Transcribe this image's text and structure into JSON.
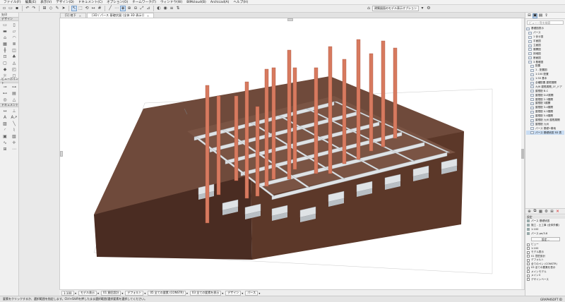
{
  "menu": [
    "ファイル(F)",
    "編集(E)",
    "表示(V)",
    "デザイン(D)",
    "ドキュメント(C)",
    "オプション(O)",
    "チームワーク(T)",
    "ウィンドウ(W)",
    "BIMcloud(B)",
    "Archicad(A)",
    "ヘルプ(H)"
  ],
  "toolbar": {
    "view_dropdown": "建築図面のモデル表示オプション",
    "suffix": "・"
  },
  "toolbox": {
    "header": "矢印",
    "categories": [
      "デザイン",
      "ビューポイント",
      "ドキュメント"
    ]
  },
  "tabs": [
    {
      "label": "[1] 地下",
      "active": false
    },
    {
      "label": "[3D / パース 基礎伏図 (全体 3D 表示)]",
      "active": true
    }
  ],
  "viewbar": [
    {
      "label": "",
      "value": "1:100"
    },
    {
      "label": "モデル表示",
      "value": ""
    },
    {
      "label": "",
      "value": "01 意匠設計"
    },
    {
      "label": "",
      "value": "デフォルト"
    },
    {
      "label": "",
      "value": "05 全ての要素 (CONSTR)"
    },
    {
      "label": "",
      "value": "03 全ての要素を表示"
    },
    {
      "label": "",
      "value": "デザイン"
    },
    {
      "label": "",
      "value": "パース"
    }
  ],
  "statusbar": {
    "hint": "要素をクリックするか、選択範囲を指定します。Ctrl+Shiftを押したまま選択範囲/選択要素を選択してください。",
    "brand": "GRAPHISOFT ID"
  },
  "rightpanel": {
    "search_placeholder": "ビュー一覧を検索",
    "tree": [
      {
        "label": "基礎図表示",
        "selected": false,
        "indent": 0
      },
      {
        "label": "パース",
        "selected": false,
        "indent": 1
      },
      {
        "label": "1 伏せ図",
        "selected": false,
        "indent": 1
      },
      {
        "label": "平面図",
        "selected": false,
        "indent": 1
      },
      {
        "label": "立面図",
        "selected": false,
        "indent": 1
      },
      {
        "label": "展開図",
        "selected": false,
        "indent": 1
      },
      {
        "label": "詳細図",
        "selected": false,
        "indent": 1
      },
      {
        "label": "断面図",
        "selected": false,
        "indent": 1
      },
      {
        "label": "3 基礎図",
        "selected": false,
        "indent": 1
      },
      {
        "label": "配置",
        "selected": false,
        "indent": 2
      },
      {
        "label": "1 - 配置図",
        "selected": false,
        "indent": 2
      },
      {
        "label": "1:100 配置",
        "selected": false,
        "indent": 2
      },
      {
        "label": "1:50 基本",
        "selected": false,
        "indent": 2
      },
      {
        "label": "全種配置 屋根展開",
        "selected": false,
        "indent": 2
      },
      {
        "label": "九州 屋根展開_1F_ドア",
        "selected": false,
        "indent": 2
      },
      {
        "label": "屋根配 B-C",
        "selected": false,
        "indent": 2
      },
      {
        "label": "屋根配 D-E展開",
        "selected": false,
        "indent": 2
      },
      {
        "label": "屋根配 2-3展開",
        "selected": false,
        "indent": 2
      },
      {
        "label": "屋根配 3展開",
        "selected": false,
        "indent": 2
      },
      {
        "label": "屋根配 3-4展開",
        "selected": false,
        "indent": 2
      },
      {
        "label": "屋根配 4-5展開",
        "selected": false,
        "indent": 2
      },
      {
        "label": "屋根配 5-6展開",
        "selected": false,
        "indent": 2
      },
      {
        "label": "屋根配 九州 屋根展開",
        "selected": false,
        "indent": 2
      },
      {
        "label": "屋根配 九州",
        "selected": false,
        "indent": 2
      },
      {
        "label": "パース 基礎+敷地",
        "selected": false,
        "indent": 2
      },
      {
        "label": "パース 基礎伏図 3D 表",
        "selected": true,
        "indent": 2
      }
    ],
    "props_title": "設定",
    "props": [
      {
        "label": "パース 基礎伏図"
      },
      {
        "label": "施工 - 土工事 (全体外観)"
      },
      {
        "label": "1:100"
      },
      {
        "label": "パース.pe/3.8"
      }
    ],
    "settings_button": "設定...",
    "options": [
      "ビュー",
      "1:100",
      "モデル表示",
      "01 意匠設計",
      "デフォルト",
      "全てのペン (CONSTR)",
      "03 全ての要素を表示",
      "メインモデル",
      "メイン3",
      "デザインベース"
    ]
  },
  "colors": {
    "soil_top": "#6f4a3b",
    "soil_left": "#4a2c22",
    "soil_front": "#5c3829",
    "concrete_top": "#dfe3e6",
    "concrete_side": "#b9bfc4",
    "column": "#d77a5f",
    "accent": "#2f6fc2",
    "danger": "#d22222"
  },
  "chart_data": null
}
